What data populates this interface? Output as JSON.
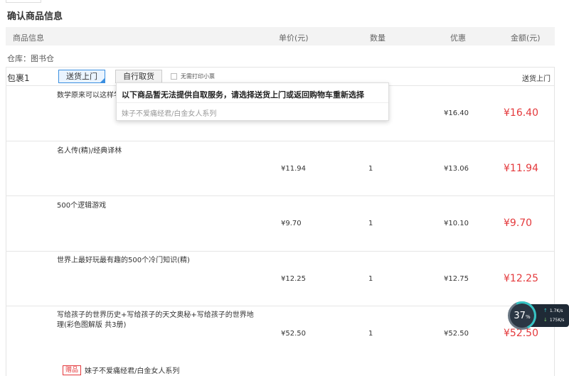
{
  "page_title": "确认商品信息",
  "columns": {
    "info": "商品信息",
    "unit_price": "单价(元)",
    "quantity": "数量",
    "discount": "优惠",
    "amount": "金额(元)"
  },
  "warehouse": "仓库：图书仓",
  "package": {
    "label": "包裹1",
    "deliver_button": "送货上门",
    "pickup_button": "自行取货",
    "no_slip_label": "无需打印小票",
    "shipping_method": "送货上门"
  },
  "popup": {
    "message": "以下商品暂无法提供自取服务，请选择送货上门或返回购物车重新选择",
    "item": "妹子不爱痛经君/白金女人系列"
  },
  "items": [
    {
      "name": "数学原来可以这样学",
      "price": "",
      "qty": "",
      "discount": "¥16.40",
      "amount": "¥16.40"
    },
    {
      "name": "名人传(精)/经典译林",
      "price": "¥11.94",
      "qty": "1",
      "discount": "¥13.06",
      "amount": "¥11.94"
    },
    {
      "name": "500个逻辑游戏",
      "price": "¥9.70",
      "qty": "1",
      "discount": "¥10.10",
      "amount": "¥9.70"
    },
    {
      "name": "世界上最好玩最有趣的500个冷门知识(精)",
      "price": "¥12.25",
      "qty": "1",
      "discount": "¥12.75",
      "amount": "¥12.25"
    },
    {
      "name": "写给孩子的世界历史+写给孩子的天文奥秘+写给孩子的世界地理(彩色图解版 共3册)",
      "price": "¥52.50",
      "qty": "1",
      "discount": "¥52.50",
      "amount": "¥52.50"
    }
  ],
  "gift": {
    "badge": "赠品",
    "name": "妹子不爱痛经君/白金女人系列"
  },
  "speed_widget": {
    "percent": "37",
    "percent_unit": "%",
    "up": "1.7K/s",
    "down": "175K/s"
  },
  "colors": {
    "amount_red": "#e4393c",
    "selected_blue": "#3b8fe0"
  }
}
